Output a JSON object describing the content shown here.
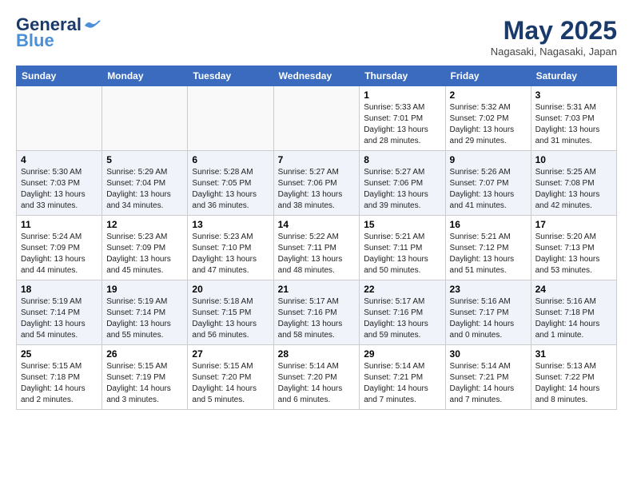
{
  "logo": {
    "line1": "General",
    "line2": "Blue"
  },
  "title": "May 2025",
  "location": "Nagasaki, Nagasaki, Japan",
  "days_header": [
    "Sunday",
    "Monday",
    "Tuesday",
    "Wednesday",
    "Thursday",
    "Friday",
    "Saturday"
  ],
  "weeks": [
    [
      {
        "day": "",
        "info": ""
      },
      {
        "day": "",
        "info": ""
      },
      {
        "day": "",
        "info": ""
      },
      {
        "day": "",
        "info": ""
      },
      {
        "day": "1",
        "info": "Sunrise: 5:33 AM\nSunset: 7:01 PM\nDaylight: 13 hours\nand 28 minutes."
      },
      {
        "day": "2",
        "info": "Sunrise: 5:32 AM\nSunset: 7:02 PM\nDaylight: 13 hours\nand 29 minutes."
      },
      {
        "day": "3",
        "info": "Sunrise: 5:31 AM\nSunset: 7:03 PM\nDaylight: 13 hours\nand 31 minutes."
      }
    ],
    [
      {
        "day": "4",
        "info": "Sunrise: 5:30 AM\nSunset: 7:03 PM\nDaylight: 13 hours\nand 33 minutes."
      },
      {
        "day": "5",
        "info": "Sunrise: 5:29 AM\nSunset: 7:04 PM\nDaylight: 13 hours\nand 34 minutes."
      },
      {
        "day": "6",
        "info": "Sunrise: 5:28 AM\nSunset: 7:05 PM\nDaylight: 13 hours\nand 36 minutes."
      },
      {
        "day": "7",
        "info": "Sunrise: 5:27 AM\nSunset: 7:06 PM\nDaylight: 13 hours\nand 38 minutes."
      },
      {
        "day": "8",
        "info": "Sunrise: 5:27 AM\nSunset: 7:06 PM\nDaylight: 13 hours\nand 39 minutes."
      },
      {
        "day": "9",
        "info": "Sunrise: 5:26 AM\nSunset: 7:07 PM\nDaylight: 13 hours\nand 41 minutes."
      },
      {
        "day": "10",
        "info": "Sunrise: 5:25 AM\nSunset: 7:08 PM\nDaylight: 13 hours\nand 42 minutes."
      }
    ],
    [
      {
        "day": "11",
        "info": "Sunrise: 5:24 AM\nSunset: 7:09 PM\nDaylight: 13 hours\nand 44 minutes."
      },
      {
        "day": "12",
        "info": "Sunrise: 5:23 AM\nSunset: 7:09 PM\nDaylight: 13 hours\nand 45 minutes."
      },
      {
        "day": "13",
        "info": "Sunrise: 5:23 AM\nSunset: 7:10 PM\nDaylight: 13 hours\nand 47 minutes."
      },
      {
        "day": "14",
        "info": "Sunrise: 5:22 AM\nSunset: 7:11 PM\nDaylight: 13 hours\nand 48 minutes."
      },
      {
        "day": "15",
        "info": "Sunrise: 5:21 AM\nSunset: 7:11 PM\nDaylight: 13 hours\nand 50 minutes."
      },
      {
        "day": "16",
        "info": "Sunrise: 5:21 AM\nSunset: 7:12 PM\nDaylight: 13 hours\nand 51 minutes."
      },
      {
        "day": "17",
        "info": "Sunrise: 5:20 AM\nSunset: 7:13 PM\nDaylight: 13 hours\nand 53 minutes."
      }
    ],
    [
      {
        "day": "18",
        "info": "Sunrise: 5:19 AM\nSunset: 7:14 PM\nDaylight: 13 hours\nand 54 minutes."
      },
      {
        "day": "19",
        "info": "Sunrise: 5:19 AM\nSunset: 7:14 PM\nDaylight: 13 hours\nand 55 minutes."
      },
      {
        "day": "20",
        "info": "Sunrise: 5:18 AM\nSunset: 7:15 PM\nDaylight: 13 hours\nand 56 minutes."
      },
      {
        "day": "21",
        "info": "Sunrise: 5:17 AM\nSunset: 7:16 PM\nDaylight: 13 hours\nand 58 minutes."
      },
      {
        "day": "22",
        "info": "Sunrise: 5:17 AM\nSunset: 7:16 PM\nDaylight: 13 hours\nand 59 minutes."
      },
      {
        "day": "23",
        "info": "Sunrise: 5:16 AM\nSunset: 7:17 PM\nDaylight: 14 hours\nand 0 minutes."
      },
      {
        "day": "24",
        "info": "Sunrise: 5:16 AM\nSunset: 7:18 PM\nDaylight: 14 hours\nand 1 minute."
      }
    ],
    [
      {
        "day": "25",
        "info": "Sunrise: 5:15 AM\nSunset: 7:18 PM\nDaylight: 14 hours\nand 2 minutes."
      },
      {
        "day": "26",
        "info": "Sunrise: 5:15 AM\nSunset: 7:19 PM\nDaylight: 14 hours\nand 3 minutes."
      },
      {
        "day": "27",
        "info": "Sunrise: 5:15 AM\nSunset: 7:20 PM\nDaylight: 14 hours\nand 5 minutes."
      },
      {
        "day": "28",
        "info": "Sunrise: 5:14 AM\nSunset: 7:20 PM\nDaylight: 14 hours\nand 6 minutes."
      },
      {
        "day": "29",
        "info": "Sunrise: 5:14 AM\nSunset: 7:21 PM\nDaylight: 14 hours\nand 7 minutes."
      },
      {
        "day": "30",
        "info": "Sunrise: 5:14 AM\nSunset: 7:21 PM\nDaylight: 14 hours\nand 7 minutes."
      },
      {
        "day": "31",
        "info": "Sunrise: 5:13 AM\nSunset: 7:22 PM\nDaylight: 14 hours\nand 8 minutes."
      }
    ]
  ]
}
